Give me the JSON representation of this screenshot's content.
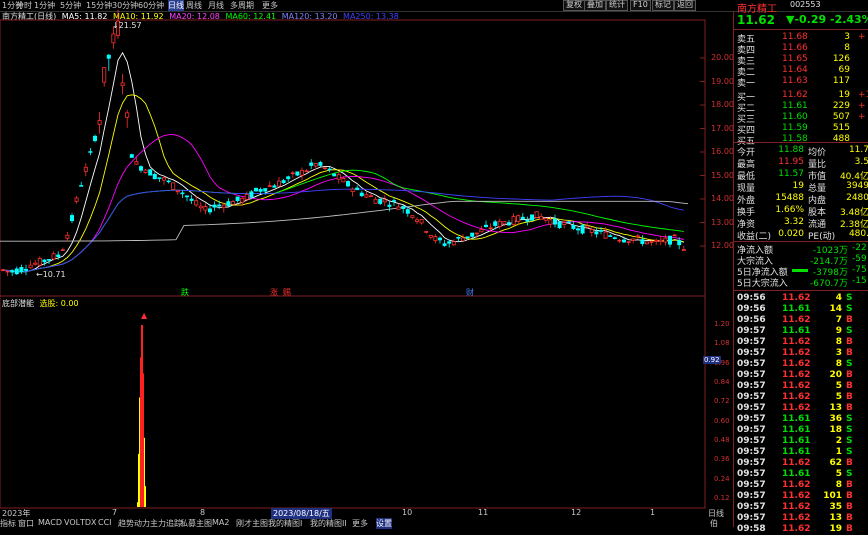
{
  "toolbar": {
    "periods": [
      "1分钟",
      "分时",
      "1分钟",
      "5分钟",
      "15分钟",
      "30分钟",
      "60分钟",
      "日线",
      "周线",
      "月线",
      "多周期",
      "更多"
    ],
    "active_period": "日线",
    "buttons": [
      "复权",
      "叠加",
      "统计",
      "F10",
      "标记",
      "返回"
    ]
  },
  "legend": {
    "stock_label": "南方精工(日线)",
    "ma5": "MA5: 11.82",
    "ma10": "MA10: 11.92",
    "ma20": "MA20: 12.08",
    "ma60": "MA60: 12.41",
    "ma120": "MA120: 13.20",
    "ma250": "MA250: 13.38"
  },
  "colors": {
    "up": "#ff3030",
    "down": "#00ffff",
    "ma5": "#ffffff",
    "ma10": "#ffff00",
    "ma20": "#ff00ff",
    "ma60": "#00ff00",
    "ma120": "#4040ff",
    "ma250": "#c0c0c0",
    "grid": "#802020"
  },
  "main_chart": {
    "price_ticks": [
      "20.00",
      "19.00",
      "18.00",
      "17.00",
      "16.00",
      "15.00",
      "14.00",
      "13.00",
      "12.00"
    ],
    "high_marker": "21.57",
    "low_marker": "10.71",
    "event_markers": [
      "跌",
      "涨",
      "赐",
      "财"
    ]
  },
  "indicator": {
    "name": "底部潜能",
    "sub_label": "选股: 0.00",
    "ticks": [
      "1.20",
      "1.08",
      "0.96",
      "0.84",
      "0.72",
      "0.60",
      "0.48",
      "0.36",
      "0.24",
      "0.12"
    ],
    "current_value": "0.92"
  },
  "x_axis": {
    "labels": [
      "2023年",
      "7",
      "8",
      "9",
      "10",
      "11",
      "12",
      "1"
    ],
    "cursor_date": "2023/08/18/五"
  },
  "bottom_tabs": [
    "指标",
    "窗口",
    "MACD",
    "VOL",
    "TDX",
    "CCI",
    "趋势动力",
    "主力追踪",
    "私募主图",
    "MA2",
    "刚才主图",
    "我的精图I",
    "我的精图II",
    "更多",
    "设置"
  ],
  "active_bottom_tab": "设置",
  "right_controls": [
    "日线",
    "伯"
  ],
  "quote": {
    "name": "南方精工",
    "code": "002553",
    "price": "11.62",
    "change": "▼-0.29",
    "change_pct": "-2.43%"
  },
  "order_book": [
    {
      "label": "卖五",
      "price": "11.68",
      "vol": "3",
      "chg": "+"
    },
    {
      "label": "卖四",
      "price": "11.66",
      "vol": "8",
      "chg": ""
    },
    {
      "label": "卖三",
      "price": "11.65",
      "vol": "126",
      "chg": ""
    },
    {
      "label": "卖二",
      "price": "11.64",
      "vol": "69",
      "chg": ""
    },
    {
      "label": "卖一",
      "price": "11.63",
      "vol": "117",
      "chg": ""
    },
    {
      "label": "买一",
      "price": "11.62",
      "vol": "19",
      "chg": "+1"
    },
    {
      "label": "买二",
      "price": "11.61",
      "vol": "229",
      "chg": "+"
    },
    {
      "label": "买三",
      "price": "11.60",
      "vol": "507",
      "chg": "+"
    },
    {
      "label": "买四",
      "price": "11.59",
      "vol": "515",
      "chg": ""
    },
    {
      "label": "买五",
      "price": "11.58",
      "vol": "488",
      "chg": ""
    }
  ],
  "stats": [
    {
      "l1": "今开",
      "v1": "11.88",
      "l2": "均价",
      "v2": "11.7"
    },
    {
      "l1": "最高",
      "v1": "11.95",
      "l2": "量比",
      "v2": "3.5"
    },
    {
      "l1": "最低",
      "v1": "11.57",
      "l2": "市值",
      "v2": "40.4亿"
    },
    {
      "l1": "现量",
      "v1": "19",
      "l2": "总量",
      "v2": "3949"
    },
    {
      "l1": "外盘",
      "v1": "15488",
      "l2": "内盘",
      "v2": "2480"
    },
    {
      "l1": "换手",
      "v1": "1.66%",
      "l2": "股本",
      "v2": "3.48亿"
    },
    {
      "l1": "净资",
      "v1": "3.32",
      "l2": "流通",
      "v2": "2.38亿"
    },
    {
      "l1": "收益(二)",
      "v1": "0.020",
      "l2": "PE(动)",
      "v2": "480."
    }
  ],
  "flows": [
    {
      "label": "净流入额",
      "value": "-1023万",
      "pct": "-22"
    },
    {
      "label": "大宗流入",
      "value": "-214.7万",
      "pct": "-59"
    },
    {
      "label": "5日净流入额",
      "value": "-3798万",
      "pct": "-75"
    },
    {
      "label": "5日大宗流入",
      "value": "-670.7万",
      "pct": "-15"
    }
  ],
  "ticks": [
    {
      "time": "09:56",
      "price": "11.62",
      "vol": "4",
      "side": "S"
    },
    {
      "time": "09:56",
      "price": "11.61",
      "vol": "14",
      "side": "S"
    },
    {
      "time": "09:56",
      "price": "11.62",
      "vol": "7",
      "side": "B"
    },
    {
      "time": "09:57",
      "price": "11.61",
      "vol": "9",
      "side": "S"
    },
    {
      "time": "09:57",
      "price": "11.62",
      "vol": "8",
      "side": "B"
    },
    {
      "time": "09:57",
      "price": "11.62",
      "vol": "3",
      "side": "B"
    },
    {
      "time": "09:57",
      "price": "11.62",
      "vol": "8",
      "side": "S"
    },
    {
      "time": "09:57",
      "price": "11.62",
      "vol": "20",
      "side": "B"
    },
    {
      "time": "09:57",
      "price": "11.62",
      "vol": "5",
      "side": "B"
    },
    {
      "time": "09:57",
      "price": "11.62",
      "vol": "5",
      "side": "B"
    },
    {
      "time": "09:57",
      "price": "11.62",
      "vol": "13",
      "side": "B"
    },
    {
      "time": "09:57",
      "price": "11.61",
      "vol": "36",
      "side": "S"
    },
    {
      "time": "09:57",
      "price": "11.61",
      "vol": "18",
      "side": "S"
    },
    {
      "time": "09:57",
      "price": "11.61",
      "vol": "2",
      "side": "S"
    },
    {
      "time": "09:57",
      "price": "11.61",
      "vol": "1",
      "side": "S"
    },
    {
      "time": "09:57",
      "price": "11.62",
      "vol": "62",
      "side": "B"
    },
    {
      "time": "09:57",
      "price": "11.61",
      "vol": "5",
      "side": "S"
    },
    {
      "time": "09:57",
      "price": "11.62",
      "vol": "8",
      "side": "B"
    },
    {
      "time": "09:57",
      "price": "11.62",
      "vol": "101",
      "side": "B"
    },
    {
      "time": "09:57",
      "price": "11.62",
      "vol": "35",
      "side": "B"
    },
    {
      "time": "09:57",
      "price": "11.62",
      "vol": "13",
      "side": "B"
    },
    {
      "time": "09:58",
      "price": "11.62",
      "vol": "19",
      "side": "B"
    }
  ]
}
